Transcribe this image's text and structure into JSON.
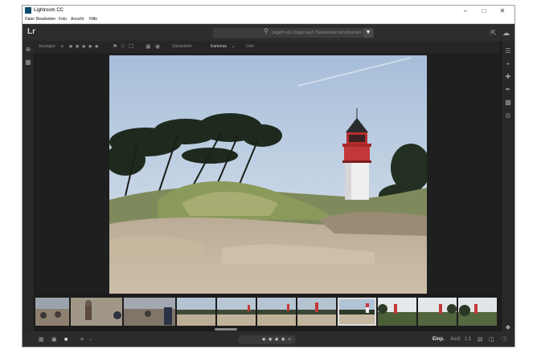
{
  "window": {
    "title": "Lightroom CC"
  },
  "menu": [
    "Datei",
    "Bearbeiten",
    "Foto",
    "Ansicht",
    "Hilfe"
  ],
  "topbar": {
    "logo": "Lr",
    "search_placeholder": "Segeln von Zingst nach Travemünde durchsuchen"
  },
  "filterbar": {
    "show_label": "Anzeigen",
    "rating_op": "≥",
    "stars": [
      "★",
      "★",
      "★",
      "★",
      "★"
    ],
    "keyword_label": "Stichwörter",
    "cameras_label": "Kameras",
    "date_label": "Orte"
  },
  "bottombar": {
    "stars": [
      "★",
      "★",
      "★",
      "★",
      "★"
    ],
    "fit_label": "Einp.",
    "fill_label": "Ausf.",
    "ratio_label": "1:1"
  },
  "colors": {
    "accent": "#dcdcdc",
    "app_bg": "#1f1f1f"
  },
  "filmstrip": {
    "count": 13,
    "selected_index": 7
  }
}
